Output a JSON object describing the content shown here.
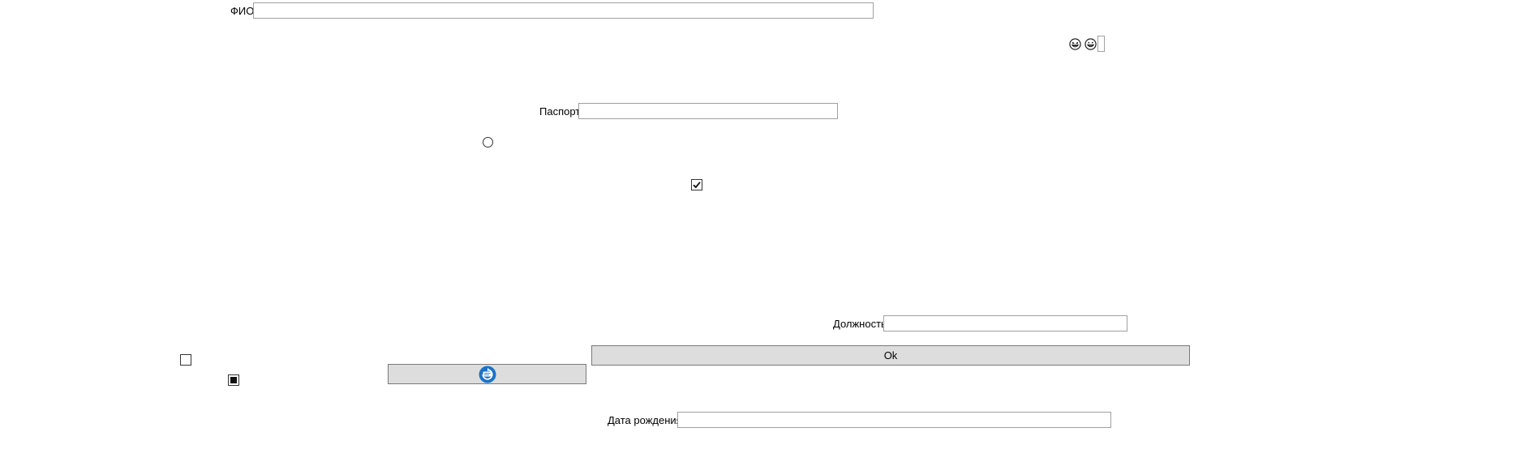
{
  "form": {
    "fio_label": "ФИО",
    "fio_value": "",
    "passport_label": "Паспорт",
    "passport_value": "",
    "position_label": "Должность",
    "position_value": "",
    "birthdate_label": "Дата рождения",
    "birthdate_value": "",
    "ok_label": "Ok",
    "checkbox_checked_state": "checked",
    "checkbox_unchecked_state": "unchecked",
    "checkbox_indeterminate_state": "indeterminate",
    "radio_state": "unselected"
  },
  "icons": {
    "emoji_1": "grinning-squinting-face-icon",
    "emoji_2": "grinning-face-icon",
    "refresh_button_icon": "blue-refresh-icon"
  },
  "colors": {
    "button_bg": "#dddddd",
    "field_border": "#a0a0a0",
    "refresh_icon_blue": "#1a73c8"
  }
}
